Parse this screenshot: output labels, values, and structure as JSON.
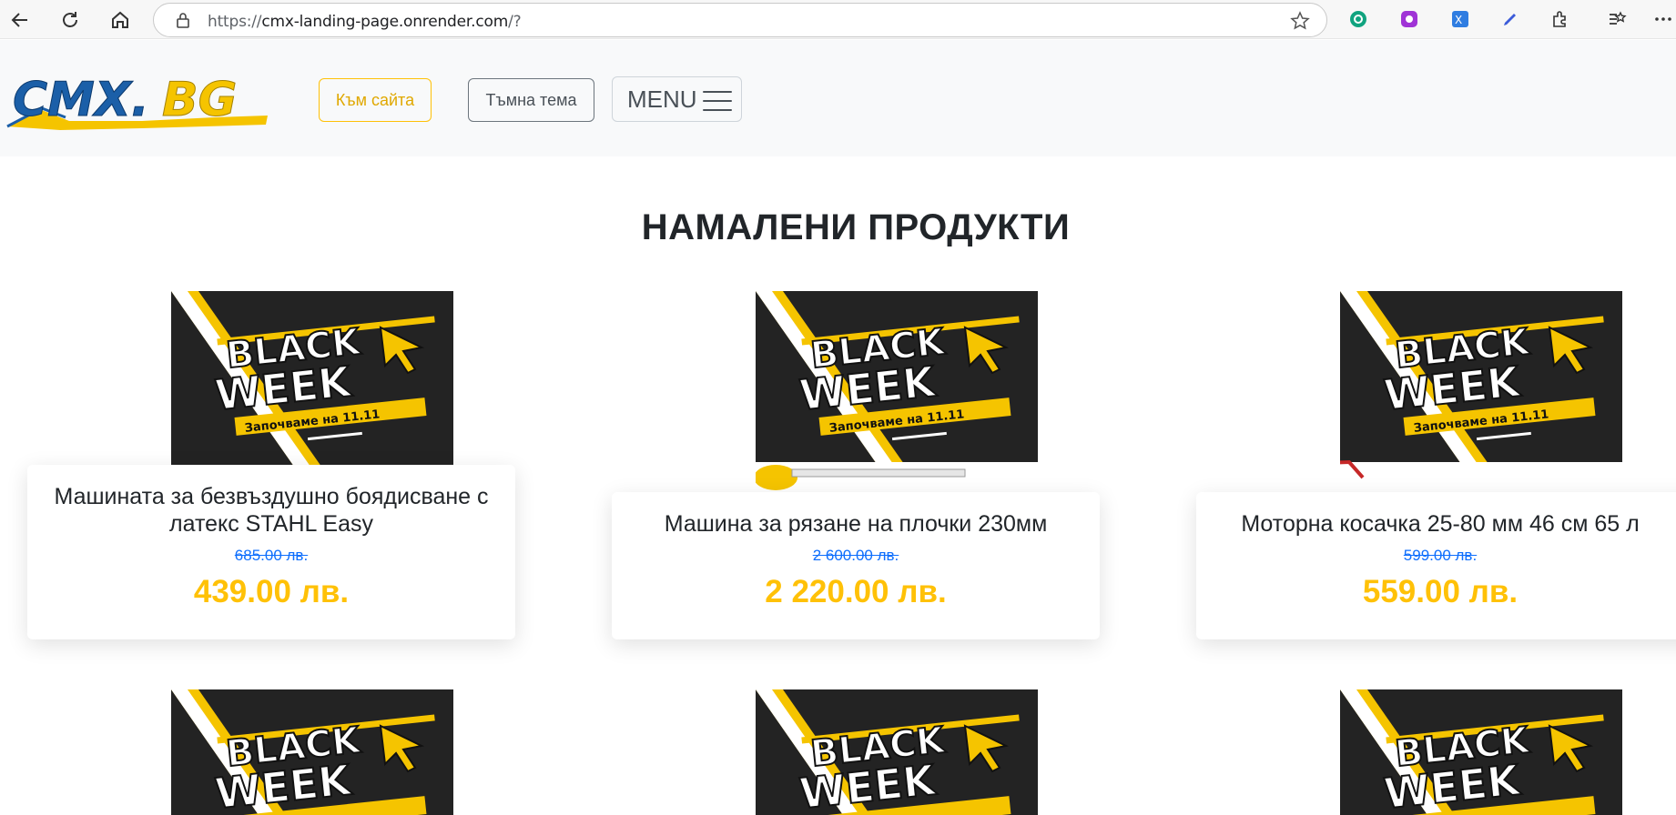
{
  "browser": {
    "url_scheme": "https://",
    "url_host": "cmx-landing-page.onrender.com",
    "url_path": "/?"
  },
  "header": {
    "logo_text": "CMX.BG",
    "to_site_label": "Към сайта",
    "dark_theme_label": "Тъмна тема",
    "menu_label": "MENU"
  },
  "main": {
    "title": "НАМАЛЕНИ ПРОДУКТИ",
    "banner": {
      "line1": "BLACK",
      "line2": "WEEK",
      "tagline": "Започваме на 11.11"
    },
    "products": [
      {
        "name": "Машината за безвъздушно боядисване с латекс STAHL Easy",
        "old_price": "685.00 лв.",
        "price": "439.00 лв."
      },
      {
        "name": "Машина за рязане на плочки 230мм",
        "old_price": "2 600.00 лв.",
        "price": "2 220.00 лв."
      },
      {
        "name": "Моторна косачка 25-80 мм 46 см 65 л",
        "old_price": "599.00 лв.",
        "price": "559.00 лв."
      }
    ]
  },
  "colors": {
    "accent": "#ffc107",
    "old_price": "#0d6efd",
    "banner_bg": "#232323"
  }
}
